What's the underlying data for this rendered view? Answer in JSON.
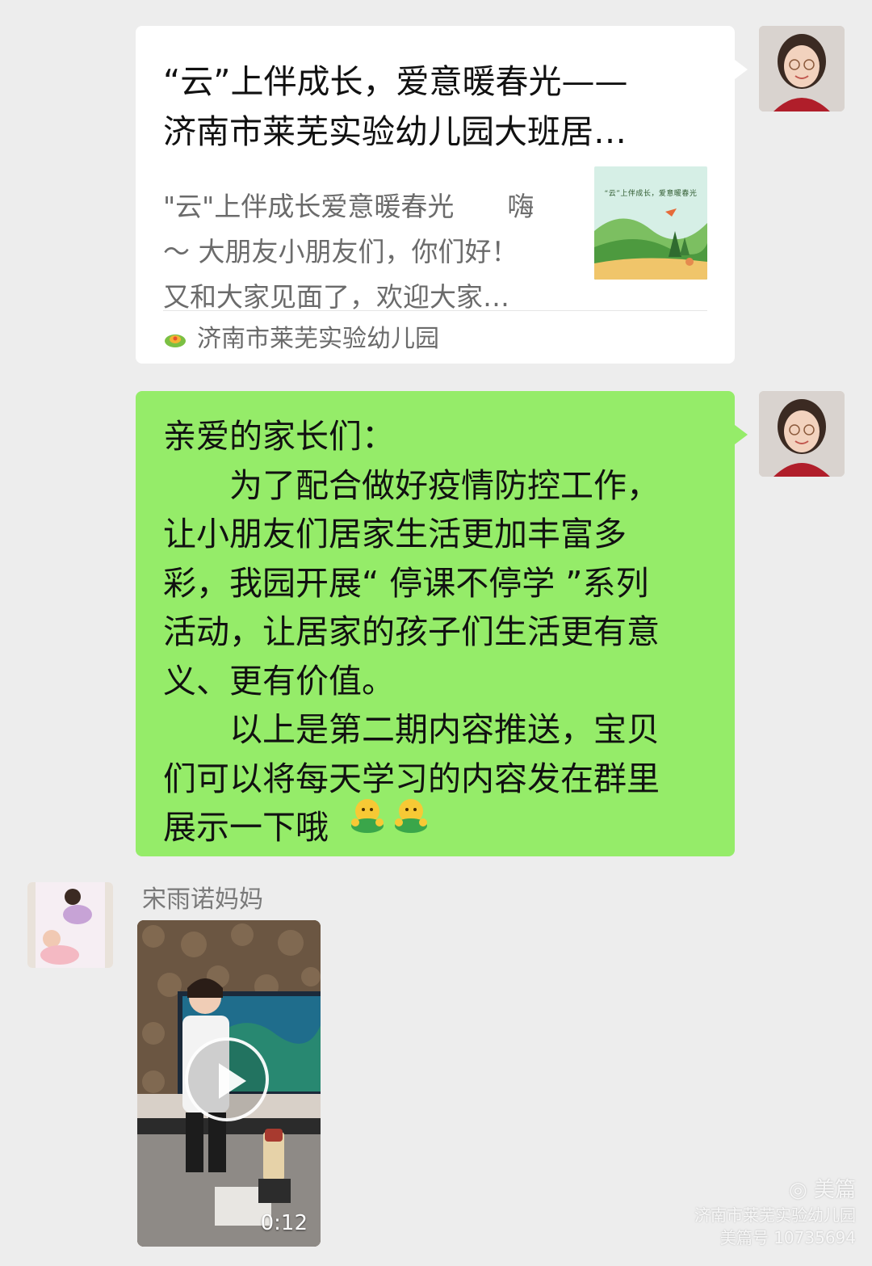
{
  "link_card": {
    "title": "“云”上伴成长，爱意暖春光——\n济南市莱芜实验幼儿园大班居…",
    "description": "\"云\"上伴成长爱意暖春光　　嗨\n～ 大朋友小朋友们，你们好！\n又和大家见面了，欢迎大家…",
    "thumbnail_caption": "“云”上伴成长，爱意暖春光",
    "source": "济南市莱芜实验幼儿园"
  },
  "message": {
    "text": "亲爱的家长们：\n　　为了配合做好疫情防控工作，\n让小朋友们居家生活更加丰富多\n彩，我园开展“ 停课不停学 ”系列\n活动，让居家的孩子们生活更有意\n义、更有价值。\n　　以上是第二期内容推送，宝贝\n们可以将每天学习的内容发在群里\n展示一下哦",
    "emojis": [
      "emoji-hug",
      "emoji-hug"
    ]
  },
  "reply": {
    "sender": "宋雨诺妈妈",
    "video_duration": "0:12"
  },
  "watermark": {
    "brand": "美篇",
    "line1": "济南市莱芜实验幼儿园",
    "line2": "美篇号 10735694"
  },
  "colors": {
    "background": "#ededed",
    "bubble_green": "#95ec69",
    "card_white": "#ffffff"
  }
}
